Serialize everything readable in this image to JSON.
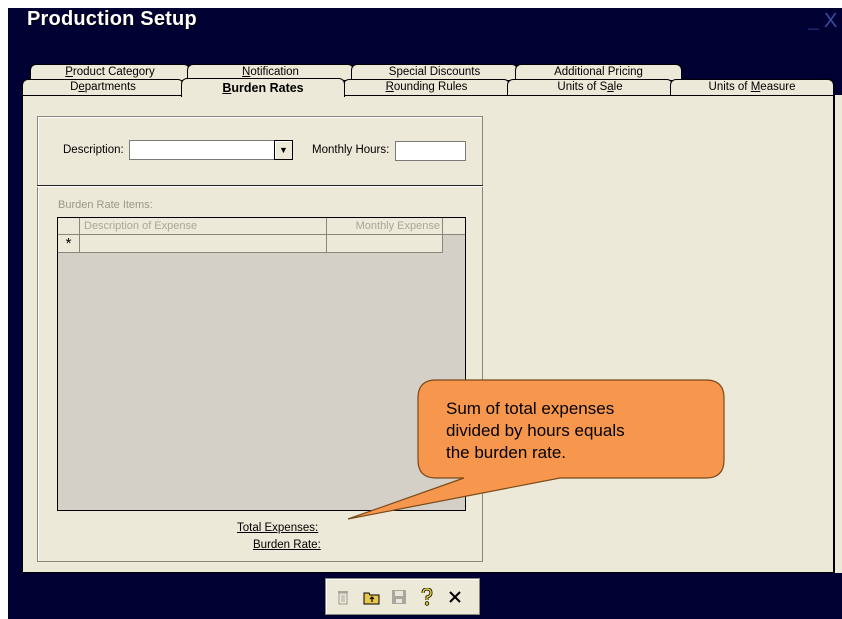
{
  "window": {
    "title": "Production Setup",
    "minimize": "_",
    "close": "X"
  },
  "tabs": {
    "back_row": [
      "Product Category",
      "Notification",
      "Special Discounts",
      "Additional Pricing"
    ],
    "front_row": [
      "Departments",
      "Burden Rates",
      "Rounding Rules",
      "Units of Sale",
      "Units of Measure"
    ],
    "active": "Burden Rates"
  },
  "form": {
    "description_label": "Description:",
    "description_value": "",
    "monthly_hours_label": "Monthly Hours:",
    "monthly_hours_value": "",
    "items_label": "Burden Rate Items:",
    "grid": {
      "columns": [
        "Description of Expense",
        "Monthly Expense"
      ],
      "new_row_marker": "*"
    },
    "total_expenses_label": "Total Expenses:",
    "burden_rate_label": "Burden Rate:"
  },
  "callout": {
    "lines": [
      "Sum of total expenses",
      "divided by hours equals",
      "the burden rate."
    ],
    "fill": "#f7974d"
  },
  "toolbar": {
    "icons": [
      "delete-icon",
      "open-folder-icon",
      "save-icon",
      "help-icon",
      "close-icon"
    ]
  },
  "colors": {
    "window_bg": "#000033",
    "panel_bg": "#ece9d8",
    "grid_bg": "#d4d0c8"
  }
}
